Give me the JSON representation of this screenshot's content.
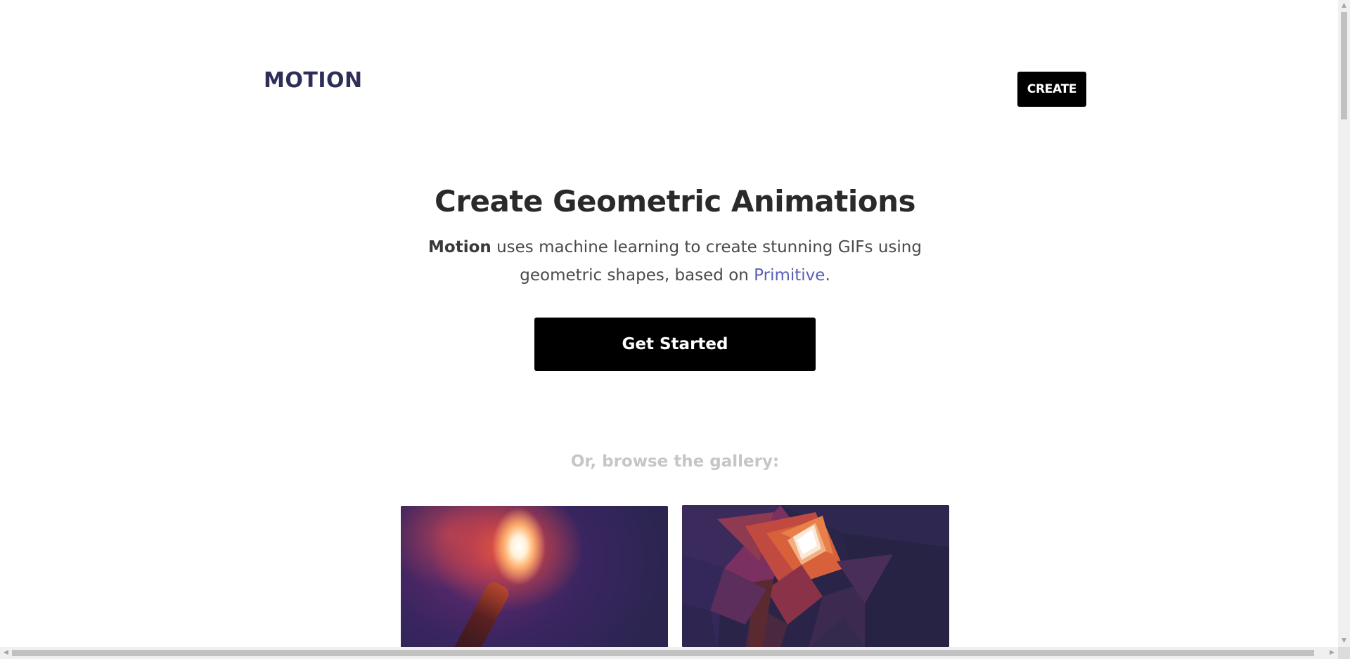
{
  "header": {
    "logo": "MOTION",
    "create_label": "CREATE"
  },
  "hero": {
    "title": "Create Geometric Animations",
    "subtitle_brand": "Motion",
    "subtitle_text": " uses machine learning to create stunning GIFs using geometric shapes, based on ",
    "subtitle_link": "Primitive",
    "subtitle_end": ".",
    "cta_label": "Get Started"
  },
  "gallery": {
    "prompt": "Or, browse the gallery:",
    "items": [
      {
        "kind": "original photo"
      },
      {
        "kind": "geometric rendering"
      }
    ]
  },
  "colors": {
    "logo": "#2f2e58",
    "link": "#5a5fb8",
    "button_bg": "#000000",
    "button_text": "#ffffff",
    "muted_text": "#c6c6c6"
  }
}
